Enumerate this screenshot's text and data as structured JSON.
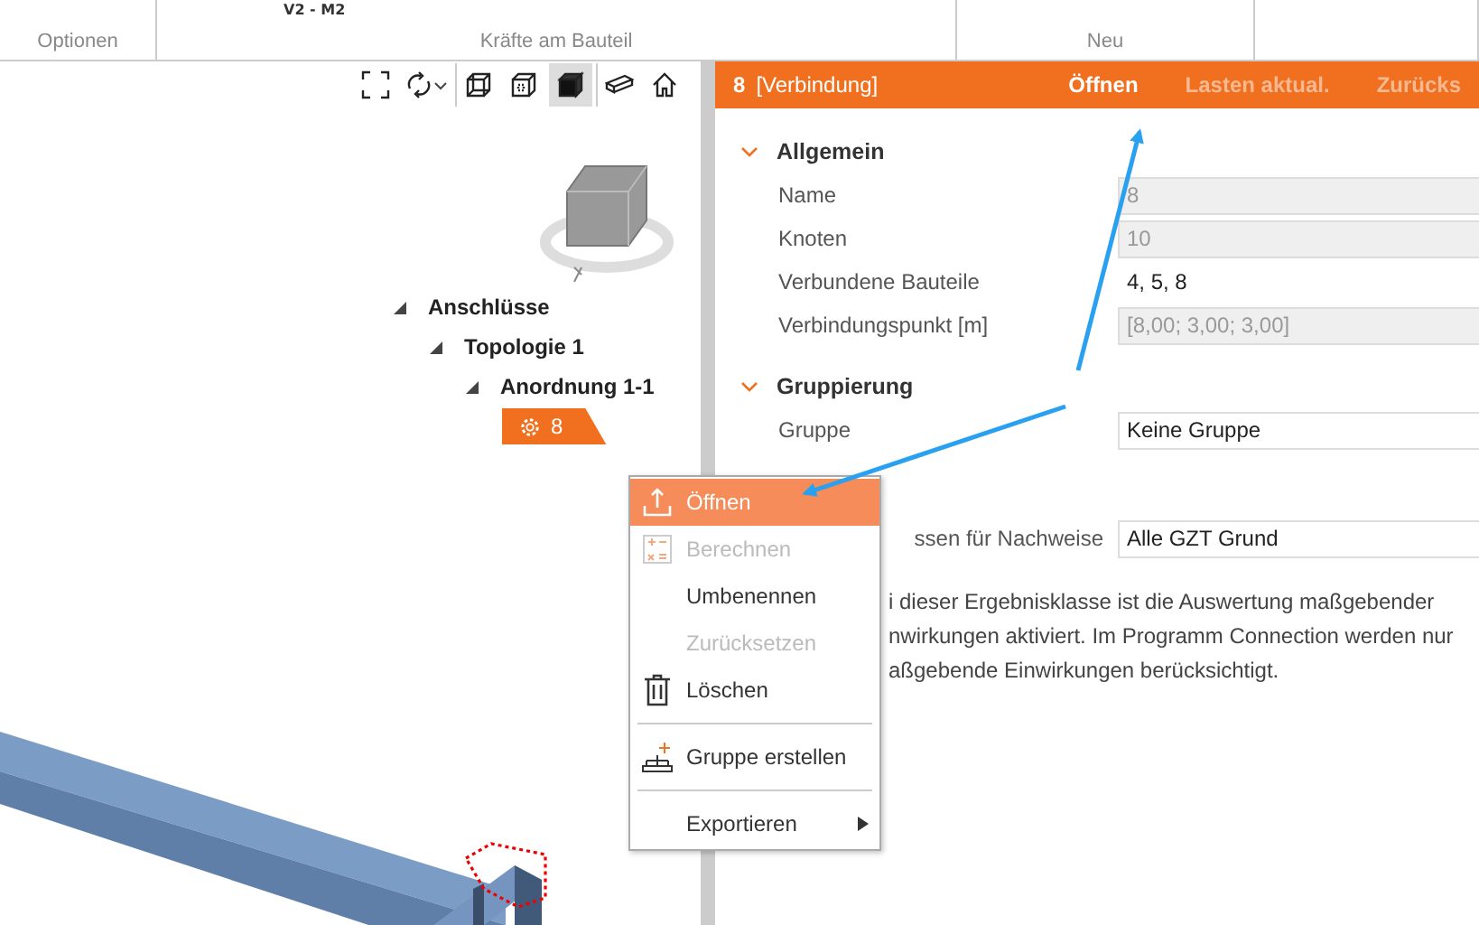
{
  "ribbon": {
    "top_text": "V2 - M2",
    "groups": [
      {
        "label": "Optionen"
      },
      {
        "label": "Kräfte am Bauteil"
      },
      {
        "label": "Neu"
      }
    ]
  },
  "view_toolbar": {
    "tools": [
      {
        "selected": false
      },
      {
        "selected": false
      },
      {
        "selected": false
      },
      {
        "selected": false
      },
      {
        "selected": true
      },
      {
        "selected": false
      },
      {
        "selected": false
      }
    ]
  },
  "tree": [
    {
      "label": "Anschlüsse",
      "expanded": true,
      "selected": false,
      "children": [
        {
          "label": "Topologie 1",
          "expanded": true,
          "selected": false,
          "children": [
            {
              "label": "Anordnung 1-1",
              "expanded": true,
              "selected": false,
              "children": [
                {
                  "label": "8",
                  "selected": true
                }
              ]
            }
          ]
        }
      ]
    }
  ],
  "panel": {
    "header": {
      "number": "8",
      "type": "[Verbindung]",
      "actions": [
        {
          "label": "Öffnen",
          "enabled": true
        },
        {
          "label": "Lasten aktual.",
          "enabled": false
        },
        {
          "label": "Zurücks",
          "enabled": false
        }
      ]
    },
    "sections": [
      {
        "title": "Allgemein",
        "expanded": true,
        "rows": [
          {
            "label": "Name",
            "value": "8",
            "kind": "readonly"
          },
          {
            "label": "Knoten",
            "value": "10",
            "kind": "readonly"
          },
          {
            "label": "Verbundene Bauteile",
            "value": "4, 5, 8",
            "kind": "text"
          },
          {
            "label": "Verbindungspunkt [m]",
            "value": "[8,00; 3,00; 3,00]",
            "kind": "readonly"
          }
        ]
      },
      {
        "title": "Gruppierung",
        "expanded": true,
        "rows": [
          {
            "label": "Gruppe",
            "value": "Keine Gruppe",
            "kind": "select"
          }
        ]
      }
    ],
    "result_row": {
      "label": "ssen für Nachweise",
      "value": "Alle GZT Grund"
    },
    "note_lines": [
      "i dieser Ergebnisklasse ist die Auswertung maßgebender",
      "nwirkungen aktiviert. Im Programm Connection werden nur",
      "aßgebende Einwirkungen berücksichtigt."
    ]
  },
  "context_menu": [
    {
      "label": "Öffnen",
      "selected": true,
      "disabled": false,
      "submenu": false
    },
    {
      "label": "Berechnen",
      "selected": false,
      "disabled": true,
      "submenu": false
    },
    {
      "label": "Umbenennen",
      "selected": false,
      "disabled": false,
      "submenu": false
    },
    {
      "label": "Zurücksetzen",
      "selected": false,
      "disabled": true,
      "submenu": false
    },
    {
      "label": "Löschen",
      "selected": false,
      "disabled": false,
      "submenu": false
    },
    {
      "label": "Gruppe erstellen",
      "selected": false,
      "disabled": false,
      "submenu": false
    },
    {
      "label": "Exportieren",
      "selected": false,
      "disabled": false,
      "submenu": true
    }
  ]
}
